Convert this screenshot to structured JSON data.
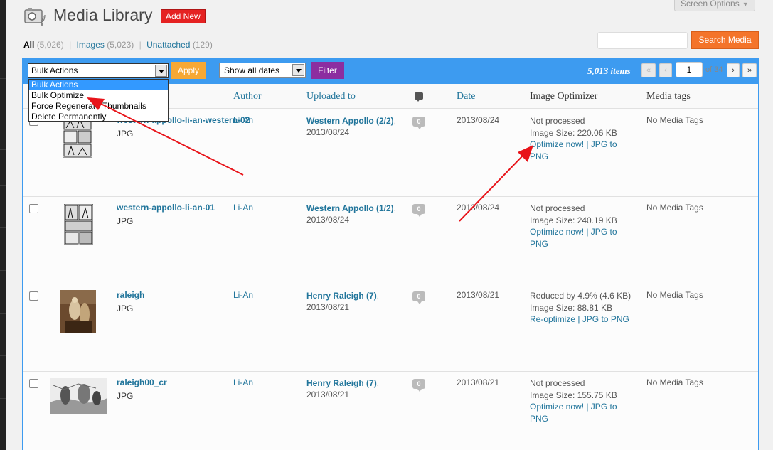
{
  "header": {
    "title": "Media Library",
    "add_new": "Add New",
    "screen_options": "Screen Options"
  },
  "filters": [
    {
      "label": "All",
      "count": "(5,026)",
      "current": true
    },
    {
      "label": "Images",
      "count": "(5,023)",
      "current": false
    },
    {
      "label": "Unattached",
      "count": "(129)",
      "current": false
    }
  ],
  "search": {
    "button": "Search Media",
    "value": ""
  },
  "toolbar": {
    "bulk_selected": "Bulk Actions",
    "bulk_options": [
      "Bulk Actions",
      "Bulk Optimize",
      "Force Regenerate Thumbnails",
      "Delete Permanently"
    ],
    "apply": "Apply",
    "date_selected": "Show all dates",
    "filter": "Filter",
    "items_count": "5,013 items",
    "page_current": "1",
    "page_of": "of 34",
    "first": "«",
    "prev": "‹",
    "next": "›",
    "last": "»"
  },
  "columns": {
    "author": "Author",
    "uploaded_to": "Uploaded to",
    "date": "Date",
    "image_optimizer": "Image Optimizer",
    "media_tags": "Media tags"
  },
  "rows": [
    {
      "title": "western-appollo-li-an-western-02",
      "type": "JPG",
      "author": "Li-An",
      "uploaded_link": "Western Appollo (2/2)",
      "uploaded_date": "2013/08/24",
      "comments": "0",
      "date": "2013/08/24",
      "opt_status": "Not processed",
      "opt_size": "Image Size: 220.06 KB",
      "opt_action": "Optimize now! | JPG to PNG",
      "tags": "No Media Tags"
    },
    {
      "title": "western-appollo-li-an-01",
      "type": "JPG",
      "author": "Li-An",
      "uploaded_link": "Western Appollo (1/2)",
      "uploaded_date": "2013/08/24",
      "comments": "0",
      "date": "2013/08/24",
      "opt_status": "Not processed",
      "opt_size": "Image Size: 240.19 KB",
      "opt_action": "Optimize now! | JPG to PNG",
      "tags": "No Media Tags"
    },
    {
      "title": "raleigh",
      "type": "JPG",
      "author": "Li-An",
      "uploaded_link": "Henry Raleigh (7)",
      "uploaded_date": "2013/08/21",
      "comments": "0",
      "date": "2013/08/21",
      "opt_status": "Reduced by 4.9% (4.6 KB)",
      "opt_size": "Image Size: 88.81 KB",
      "opt_action": "Re-optimize | JPG to PNG",
      "tags": "No Media Tags"
    },
    {
      "title": "raleigh00_cr",
      "type": "JPG",
      "author": "Li-An",
      "uploaded_link": "Henry Raleigh (7)",
      "uploaded_date": "2013/08/21",
      "comments": "0",
      "date": "2013/08/21",
      "opt_status": "Not processed",
      "opt_size": "Image Size: 155.75 KB",
      "opt_action": "Optimize now! | JPG to PNG",
      "tags": "No Media Tags"
    }
  ],
  "colors": {
    "accent_blue": "#3d9bf0",
    "add_new_red": "#e52222",
    "apply_orange": "#f6a835",
    "filter_purple": "#8c2da0",
    "search_orange": "#f4742a",
    "arrow_red": "#e8141a"
  }
}
